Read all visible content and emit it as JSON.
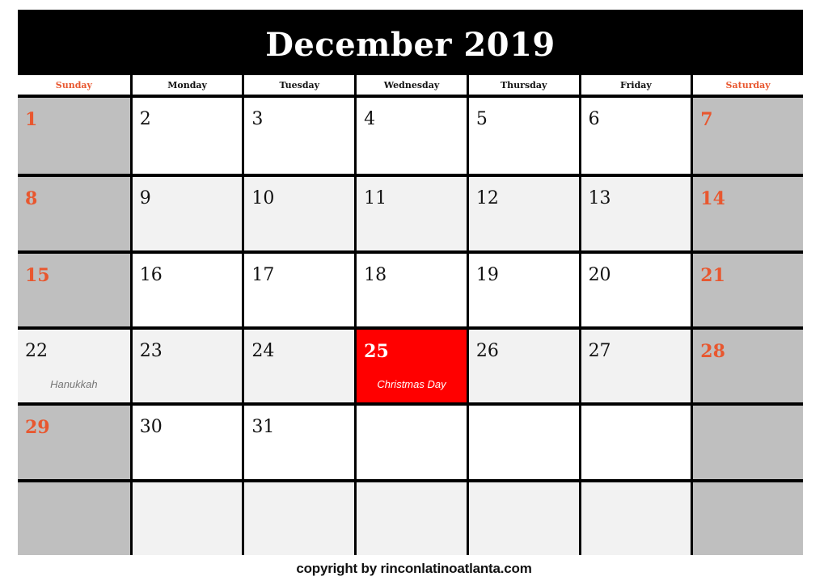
{
  "title": "December 2019",
  "colors": {
    "header_bg": "#000000",
    "weekend_text": "#e8572f",
    "weekend_cell": "#bfbfbf",
    "alt_row_cell": "#f2f2f2",
    "christmas_cell": "#ff0000"
  },
  "weekdays": [
    "Sunday",
    "Monday",
    "Tuesday",
    "Wednesday",
    "Thursday",
    "Friday",
    "Saturday"
  ],
  "weeks": [
    [
      {
        "day": "1"
      },
      {
        "day": "2"
      },
      {
        "day": "3"
      },
      {
        "day": "4"
      },
      {
        "day": "5"
      },
      {
        "day": "6"
      },
      {
        "day": "7"
      }
    ],
    [
      {
        "day": "8"
      },
      {
        "day": "9"
      },
      {
        "day": "10"
      },
      {
        "day": "11"
      },
      {
        "day": "12"
      },
      {
        "day": "13"
      },
      {
        "day": "14"
      }
    ],
    [
      {
        "day": "15"
      },
      {
        "day": "16"
      },
      {
        "day": "17"
      },
      {
        "day": "18"
      },
      {
        "day": "19"
      },
      {
        "day": "20"
      },
      {
        "day": "21"
      }
    ],
    [
      {
        "day": "22",
        "event": "Hanukkah",
        "highlight": "light"
      },
      {
        "day": "23"
      },
      {
        "day": "24"
      },
      {
        "day": "25",
        "event": "Christmas Day",
        "highlight": "red"
      },
      {
        "day": "26"
      },
      {
        "day": "27"
      },
      {
        "day": "28"
      }
    ],
    [
      {
        "day": "29"
      },
      {
        "day": "30"
      },
      {
        "day": "31"
      },
      {
        "day": ""
      },
      {
        "day": ""
      },
      {
        "day": ""
      },
      {
        "day": ""
      }
    ],
    [
      {
        "day": ""
      },
      {
        "day": ""
      },
      {
        "day": ""
      },
      {
        "day": ""
      },
      {
        "day": ""
      },
      {
        "day": ""
      },
      {
        "day": ""
      }
    ]
  ],
  "footer": "copyright by rinconlatinoatlanta.com"
}
